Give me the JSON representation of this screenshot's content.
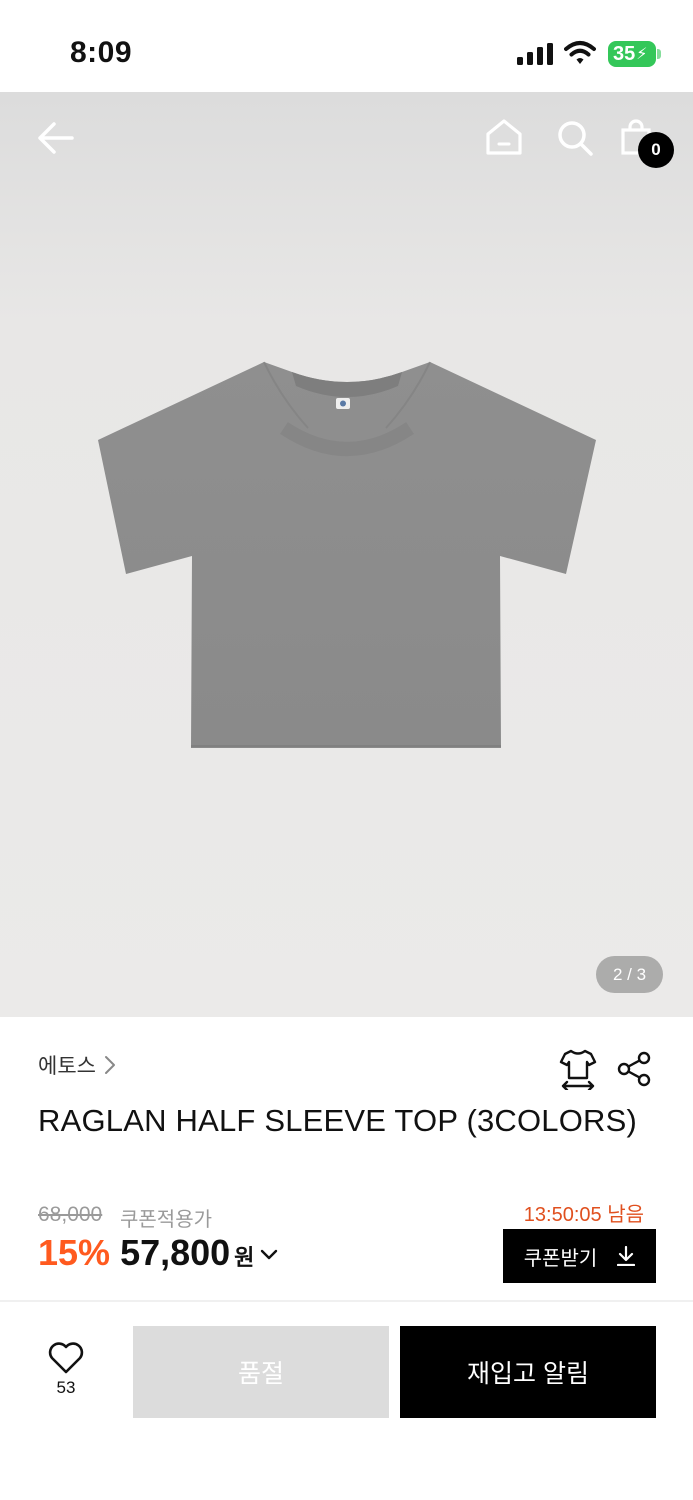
{
  "status_bar": {
    "time": "8:09",
    "battery": "35",
    "icons": [
      "signal-icon",
      "wifi-icon",
      "battery-icon"
    ]
  },
  "header": {
    "icons": [
      "back-arrow-icon",
      "home-icon",
      "search-icon",
      "shopping-bag-icon"
    ],
    "cart_count": "0"
  },
  "gallery": {
    "pager": "2 / 3",
    "image": "gray-raglan-tshirt"
  },
  "product": {
    "brand": "에토스",
    "title": "RAGLAN HALF SLEEVE TOP (3COLORS)",
    "original_price": "68,000",
    "coupon_note": "쿠폰적용가",
    "discount": "15%",
    "sale_price": "57,800",
    "currency": "원",
    "countdown": "13:50:05 남음",
    "coupon_button": "쿠폰받기"
  },
  "actions": {
    "like_count": "53",
    "soldout_label": "품절",
    "restock_label": "재입고 알림"
  },
  "colors": {
    "accent": "#ff5a1f",
    "countdown": "#e0501f",
    "primary_button": "#000000",
    "disabled_button": "#dcdcdc",
    "battery": "#34c759"
  }
}
